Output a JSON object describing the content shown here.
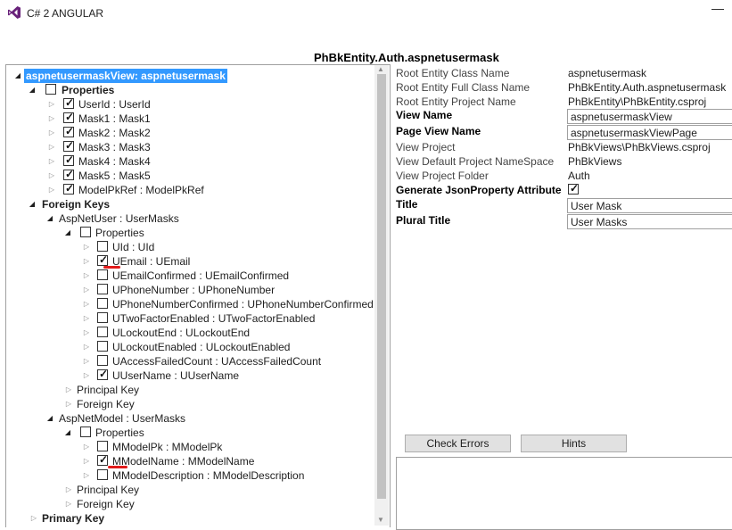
{
  "window": {
    "title": "C# 2 ANGULAR",
    "minimize_glyph": "—"
  },
  "header": {
    "title": "PhBkEntity.Auth.aspnetusermask"
  },
  "tree": {
    "root": "aspnetusermaskView: aspnetusermask",
    "properties_label": "Properties",
    "properties": [
      "UserId : UserId",
      "Mask1 : Mask1",
      "Mask2 : Mask2",
      "Mask3 : Mask3",
      "Mask4 : Mask4",
      "Mask5 : Mask5",
      "ModelPkRef : ModelPkRef"
    ],
    "foreign_keys_label": "Foreign Keys",
    "fk1": {
      "label": "AspNetUser : UserMasks",
      "properties_label": "Properties",
      "properties": [
        "UId : UId",
        "UEmail : UEmail",
        "UEmailConfirmed : UEmailConfirmed",
        "UPhoneNumber : UPhoneNumber",
        "UPhoneNumberConfirmed : UPhoneNumberConfirmed",
        "UTwoFactorEnabled : UTwoFactorEnabled",
        "ULockoutEnd : ULockoutEnd",
        "ULockoutEnabled : ULockoutEnabled",
        "UAccessFailedCount : UAccessFailedCount",
        "UUserName : UUserName"
      ],
      "principal_key": "Principal Key",
      "foreign_key": "Foreign Key"
    },
    "fk2": {
      "label": "AspNetModel : UserMasks",
      "properties_label": "Properties",
      "properties": [
        "MModelPk : MModelPk",
        "MModelName : MModelName",
        "MModelDescription : MModelDescription"
      ],
      "principal_key": "Principal Key",
      "foreign_key": "Foreign Key"
    },
    "primary_key_label": "Primary Key"
  },
  "props": {
    "root_entity_class_name": {
      "label": "Root Entity Class Name",
      "value": "aspnetusermask"
    },
    "root_entity_full_class_name": {
      "label": "Root Entity Full Class Name",
      "value": "PhBkEntity.Auth.aspnetusermask"
    },
    "root_entity_project_name": {
      "label": "Root Entity Project Name",
      "value": "PhBkEntity\\PhBkEntity.csproj"
    },
    "view_name": {
      "label": "View Name",
      "value": "aspnetusermaskView"
    },
    "page_view_name": {
      "label": "Page View Name",
      "value": "aspnetusermaskViewPage"
    },
    "view_project": {
      "label": "View Project",
      "value": "PhBkViews\\PhBkViews.csproj"
    },
    "view_default_namespace": {
      "label": "View Default Project NameSpace",
      "value": "PhBkViews"
    },
    "view_project_folder": {
      "label": "View Project Folder",
      "value": "Auth"
    },
    "generate_json": {
      "label": "Generate JsonProperty Attribute",
      "checked": true
    },
    "title": {
      "label": "Title",
      "value": "User Mask"
    },
    "plural_title": {
      "label": "Plural Title",
      "value": "User Masks"
    }
  },
  "buttons": {
    "check_errors": "Check Errors",
    "hints": "Hints"
  },
  "colors": {
    "selection": "#3399ff",
    "annotation": "#e21b1b"
  }
}
